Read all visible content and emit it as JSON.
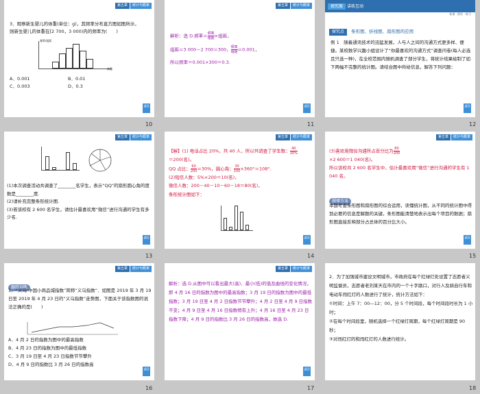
{
  "common": {
    "header_left": "第五章",
    "header_right": "统计与概率",
    "return_label": "返回"
  },
  "s10": {
    "num": "10",
    "line1": "3．观察新生婴儿的体重(单位：g)，其频率分布直方图如图所示，",
    "line2": "则新生婴儿的体重在[2 700，3 000)内的频率为(　　)",
    "opt_a": "A．0.001",
    "opt_b": "B．0.01",
    "opt_c": "C．0.003",
    "opt_d": "D．0.3",
    "y_axis_label": "频率/组距",
    "x_axis_label": "体重"
  },
  "s11": {
    "num": "11",
    "line1": "解析：选 D.频率＝",
    "frac1_num": "频率",
    "frac1_den": "组距",
    "line1b": "×组距，",
    "line2": "组距＝3 000－2 700＝300，",
    "frac2_num": "频率",
    "frac2_den": "组距",
    "line2b": "＝0.001，",
    "line3": "所以频率＝0.001×300＝0.3."
  },
  "s12": {
    "num": "12",
    "tag_left": "探究案",
    "tag_right": "讲练互动",
    "mini_header": "新课 · 探究 · 练习",
    "item_tag": "探究点",
    "item_title": "条形图、折线图、扇形图的应用",
    "para": "例 1　随着通讯技术的迅猛发展，人与人之间的沟通方式更多样、便捷。某校数学兴趣小组设计了“你最喜欢的沟通方式”调查问卷(每人必选且只选一种)，在全校范围内随机调查了部分学生，将统计结果绘制了如下两幅不完整的统计图。请结合图中所给信息，解答下列问题："
  },
  "s13": {
    "num": "13",
    "q1": "(1)本次调查活动共调查了________名学生，表示“QQ”的扇形圆心角的度数是________度.",
    "q2": "(2)请补充完整条形统计图.",
    "q3": "(3)若该校有 2 600 名学生，请估计最喜欢用“微信”进行沟通的学生有多少名.",
    "pie_labels": [
      "电话",
      "短信",
      "微信",
      "QQ",
      "其他"
    ]
  },
  "s14": {
    "num": "14",
    "head": "【解】",
    "l1": "(1) 电话占比 20%，共 40 人，所以共调查了学生数：",
    "f1_num": "40",
    "f1_den": "20%",
    "l2": "＝200(名)。",
    "l3": "QQ 占比：",
    "f2_num": "60",
    "f2_den": "200",
    "l3b": "＝30%，圆心角：",
    "f3_num": "30",
    "f3_den": "100",
    "l3c": "×360°＝108°.",
    "l4": "(2)短信人数：5%×200＝10(名)，",
    "l5": "微信人数：200－40－10－60－18＝80(名)，",
    "l6": "条形统计图如下："
  },
  "s15": {
    "num": "15",
    "l1": "(3)喜欢用微信沟通所占百分比为",
    "f1_num": "80",
    "f1_den": "200",
    "l2": "×2 600＝1 040(名)。",
    "l3": "所以该校共 2 600 名学生中，估计最喜欢用“微信”进行沟通的学生有 1 040 名。",
    "tag": "规律方法",
    "para": "本题考查条形图和扇形图的综合运用，读懂统计图，从不同的统计图中得到必要的信息是解题的关键，条形图能清楚地表示出每个项目的数据；扇形图直接反映部分占总体的百分比大小。"
  },
  "s16": {
    "num": "16",
    "tag": "跟踪训练",
    "para": "1．“义乌·中国小商品城指数”简称“义乌指数”．如图是 2019 年 3 月 19 日至 2019 年 4 月 23 日的“义乌指数”走势图，下面关于该指数图的说法正确的是(　　)",
    "opt_a": "A．4 月 2 日的指数为图中的最高指数",
    "opt_b": "B．4 月 23 日的指数为图中的最低指数",
    "opt_c": "C．3 月 19 日至 4 月 23 日指数节节攀升",
    "opt_d": "D．4 月 9 日的指数比 3 月 26 日的指数高"
  },
  "s17": {
    "num": "17",
    "para": "解析：选 D.从图中可以看出最大(高)、最小(低)的值及曲线的变化情况，即 4 月 16 日的指数为图中的最高指数；3 月 19 日的指数为图中的最低指数；3 月 19 日至 4 月 2 日指数节节攀升；4 月 2 日至 4 月 9 日指数不变；4 月 9 日至 4 月 16 日指数稍有上升；4 月 16 日至 4 月 23 日指数下降；4 月 9 日的指数比 3 月 26 日的指数高，故选 D."
  },
  "s18": {
    "num": "18",
    "para": "2．为了加强城市建设文明城市，市政府在每个红绿灯处设置了志愿者义明监督员，志愿者老刘某天在市内的一个十字路口，对行人及骑自行车和电动车闯红灯的人数进行了统计，统计方法如下：",
    "l1": "①时间：上午 7：00—12：00，分 5 个时间段，每个时间段时长为 1 小时；",
    "l2": "②在每个时间段里，随机选择一个红绿灯周期，每个红绿灯周期是 90 秒；",
    "l3": "③对闯红灯的和闯红灯的人数进行统计。"
  }
}
